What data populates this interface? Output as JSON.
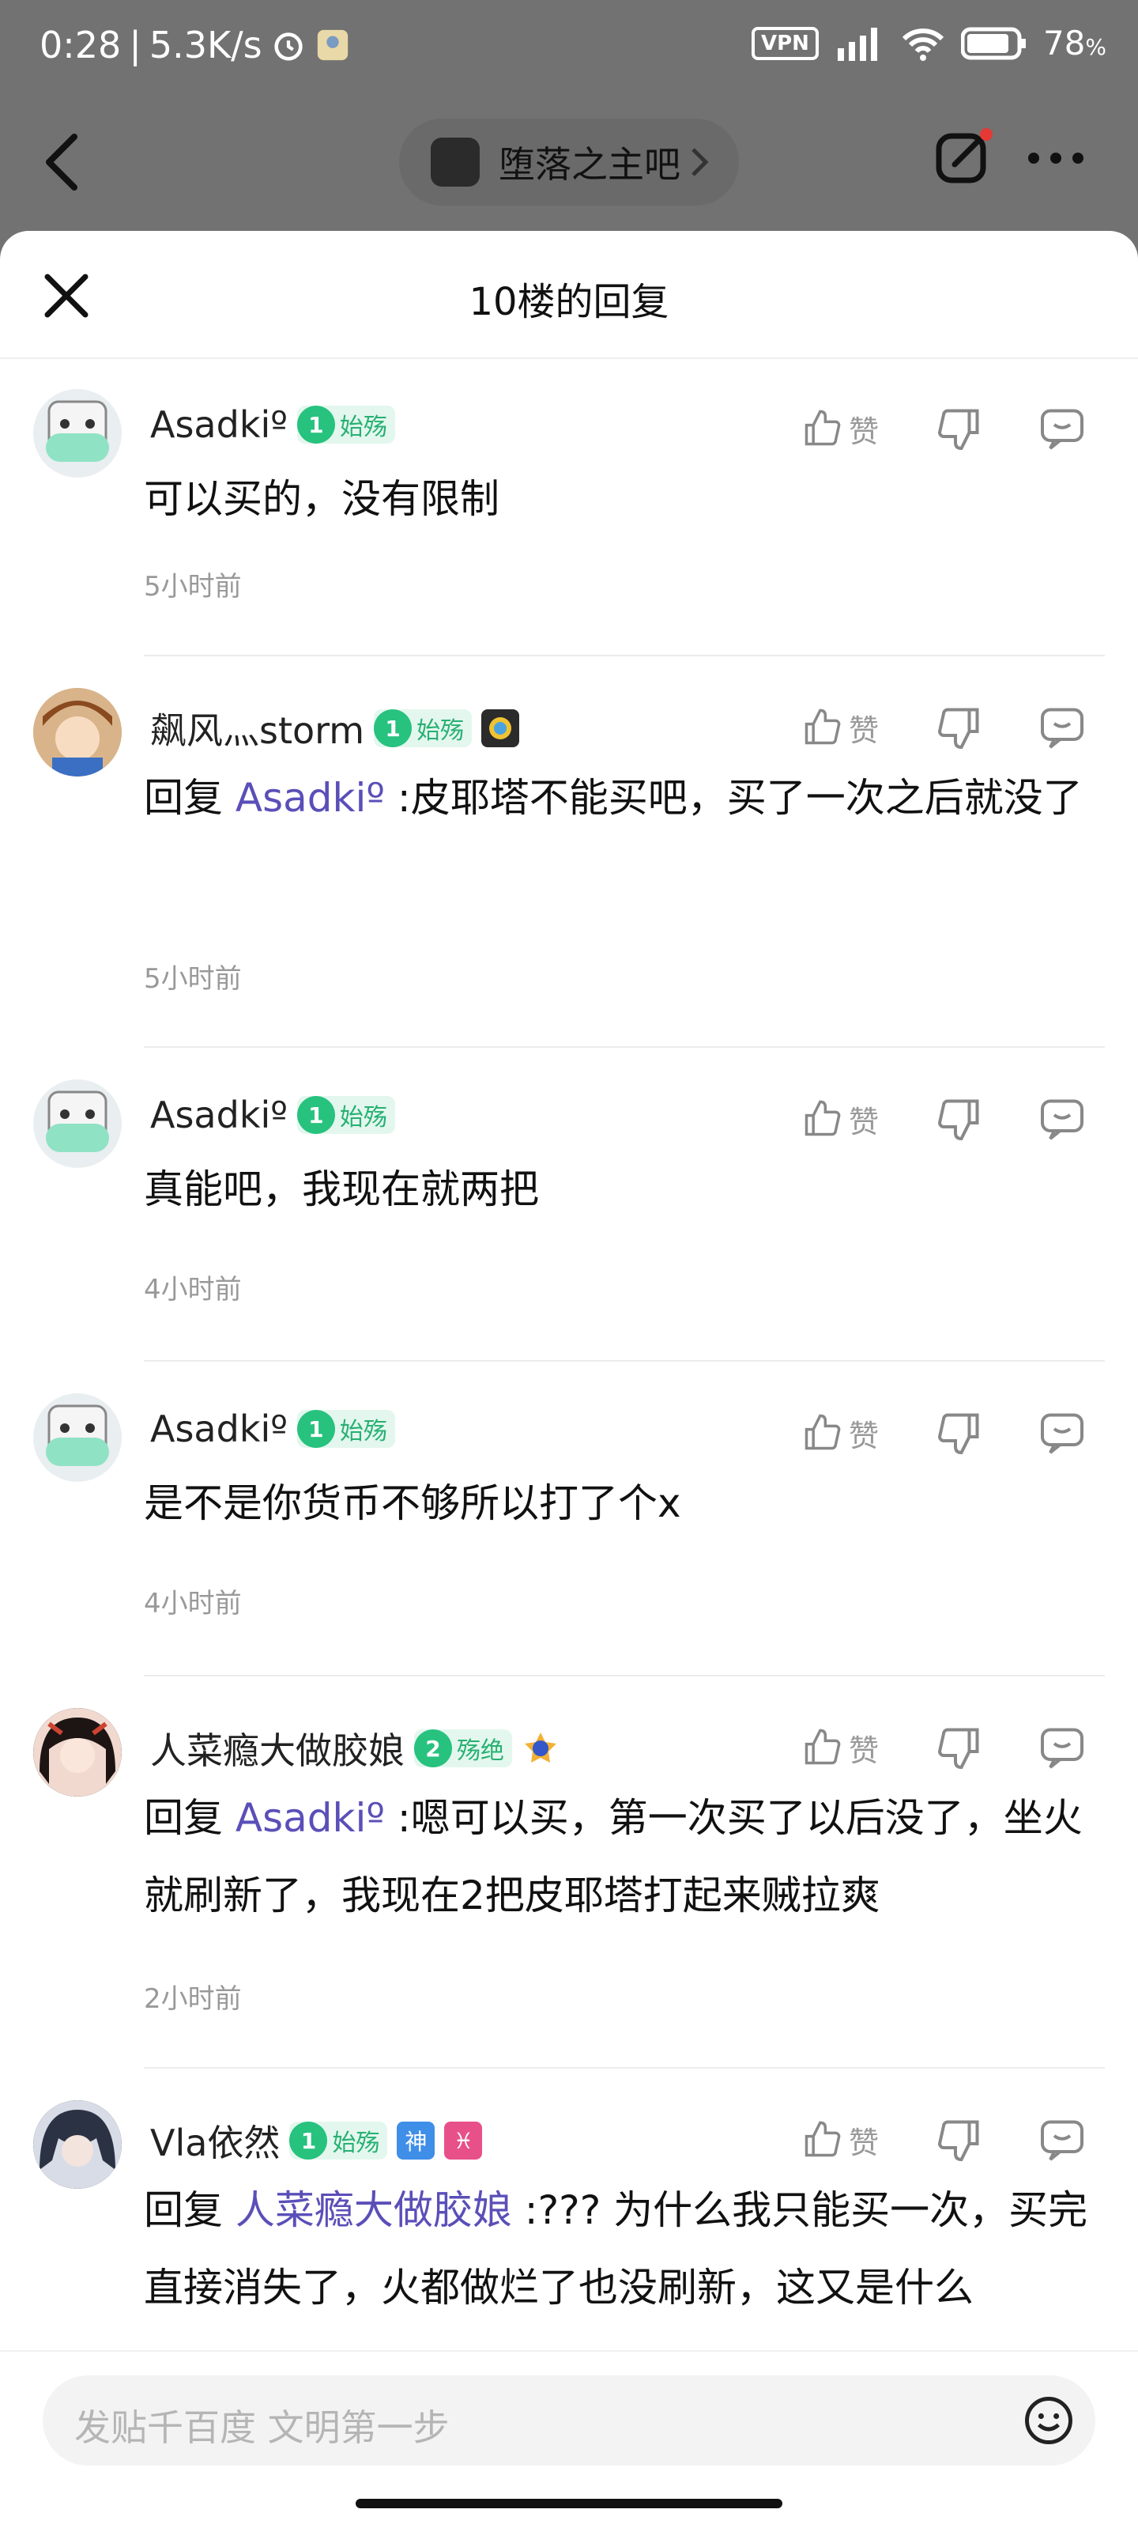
{
  "status_bar": {
    "time": "0:28",
    "speed": "5.3K/s",
    "vpn": "VPN",
    "battery": "78",
    "battery_unit": "%"
  },
  "nav": {
    "forum_name": "堕落之主吧"
  },
  "sheet": {
    "title": "10楼的回复"
  },
  "comments": [
    {
      "user": "Asadkiº",
      "level": "1",
      "level_title": "始殇",
      "prefix": "",
      "mention": "",
      "text": "可以买的，没有限制",
      "time": "5小时前",
      "like_label": "赞"
    },
    {
      "user": "飙风灬storm",
      "level": "1",
      "level_title": "始殇",
      "prefix": "回复 ",
      "mention": "Asadkiº",
      "text": " :皮耶塔不能买吧，买了一次之后就没了",
      "time": "5小时前",
      "like_label": "赞"
    },
    {
      "user": "Asadkiº",
      "level": "1",
      "level_title": "始殇",
      "prefix": "",
      "mention": "",
      "text": "真能吧，我现在就两把",
      "time": "4小时前",
      "like_label": "赞"
    },
    {
      "user": "Asadkiº",
      "level": "1",
      "level_title": "始殇",
      "prefix": "",
      "mention": "",
      "text": "是不是你货币不够所以打了个x",
      "time": "4小时前",
      "like_label": "赞"
    },
    {
      "user": "人菜瘾大做胶娘",
      "level": "2",
      "level_title": "殇绝",
      "prefix": "回复 ",
      "mention": "Asadkiº",
      "text": " :嗯可以买，第一次买了以后没了，坐火就刷新了，我现在2把皮耶塔打起来贼拉爽",
      "time": "2小时前",
      "like_label": "赞"
    },
    {
      "user": "Vla依然",
      "level": "1",
      "level_title": "始殇",
      "prefix": "回复 ",
      "mention": "人菜瘾大做胶娘",
      "text": " :??? 为什么我只能买一次，买完直接消失了，火都做烂了也没刷新，这又是什么",
      "time": "",
      "like_label": "赞"
    }
  ],
  "badges": {
    "shen": "神",
    "pisces": "♓"
  },
  "input": {
    "placeholder": "发贴千百度 文明第一步"
  },
  "colors": {
    "accent_mention": "#5a4fb8",
    "level_green": "#27c27e"
  }
}
